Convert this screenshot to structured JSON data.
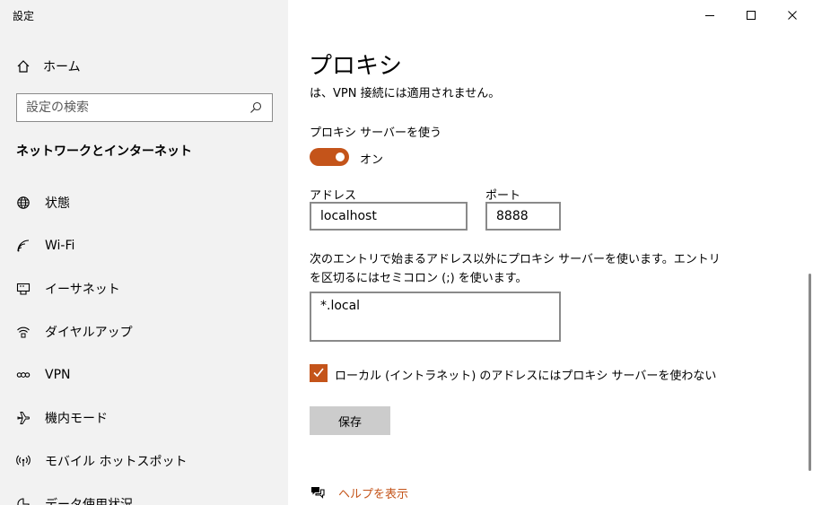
{
  "window": {
    "title": "設定",
    "minimize_icon": "minimize-icon",
    "maximize_icon": "maximize-icon",
    "close_icon": "close-icon"
  },
  "sidebar": {
    "home": {
      "label": "ホーム",
      "icon": "home-icon"
    },
    "search": {
      "placeholder": "設定の検索",
      "value": "",
      "icon": "search-icon"
    },
    "section_title": "ネットワークとインターネット",
    "items": [
      {
        "label": "状態",
        "icon": "globe-icon"
      },
      {
        "label": "Wi-Fi",
        "icon": "wifi-icon"
      },
      {
        "label": "イーサネット",
        "icon": "ethernet-icon"
      },
      {
        "label": "ダイヤルアップ",
        "icon": "dialup-icon"
      },
      {
        "label": "VPN",
        "icon": "vpn-icon"
      },
      {
        "label": "機内モード",
        "icon": "airplane-icon"
      },
      {
        "label": "モバイル ホットスポット",
        "icon": "hotspot-icon"
      },
      {
        "label": "データ使用状況",
        "icon": "data-usage-icon"
      }
    ]
  },
  "main": {
    "title": "プロキシ",
    "note": "は、VPN 接続には適用されません。",
    "use_proxy_label": "プロキシ サーバーを使う",
    "toggle_state": "オン",
    "address_label": "アドレス",
    "address_value": "localhost",
    "port_label": "ポート",
    "port_value": "8888",
    "exclude_desc": "次のエントリで始まるアドレス以外にプロキシ サーバーを使います。エントリを区切るにはセミコロン (;) を使います。",
    "exclude_value": "*.local",
    "bypass_local_label": "ローカル (イントラネット) のアドレスにはプロキシ サーバーを使わない",
    "bypass_local_checked": true,
    "save_label": "保存",
    "help_label": "ヘルプを表示",
    "help_icon": "help-chat-icon"
  },
  "colors": {
    "accent": "#c4541a",
    "sidebar_bg": "#f2f2f2",
    "button_bg": "#cccccc",
    "border": "#8a8a8a"
  }
}
